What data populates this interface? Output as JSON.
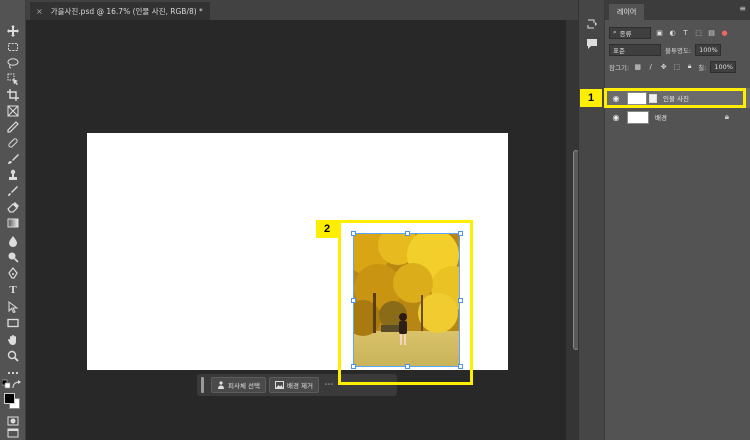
{
  "document": {
    "tab_title": "가을사진.psd @ 16.7% (인물 사진, RGB/8) *",
    "close_glyph": "×"
  },
  "toolbar": {
    "tools": [
      "move-tool",
      "marquee-tool",
      "lasso-tool",
      "object-select-tool",
      "crop-tool",
      "frame-tool",
      "eyedropper-tool",
      "healing-brush-tool",
      "brush-tool",
      "clone-stamp-tool",
      "history-brush-tool",
      "eraser-tool",
      "gradient-tool",
      "blur-tool",
      "dodge-tool",
      "pen-tool",
      "type-tool",
      "path-select-tool",
      "rectangle-tool",
      "hand-tool",
      "zoom-tool",
      "more-tools"
    ],
    "type_glyph": "T",
    "foreground_color": "#000000",
    "background_color": "#ffffff"
  },
  "taskbar": {
    "select_subject_label": "피사체 선택",
    "remove_background_label": "배경 제거",
    "more_glyph": "⋯"
  },
  "callouts": {
    "layer_callout": "1",
    "image_callout": "2",
    "highlight_color": "#ffee00"
  },
  "layers_panel": {
    "tab_label": "레이어",
    "menu_glyph": "≡",
    "filter_label": "종류",
    "blend_mode": "표준",
    "opacity_label": "불투명도:",
    "opacity_value": "100%",
    "lock_label": "잠그기:",
    "fill_label": "칠:",
    "fill_value": "100%",
    "layers": [
      {
        "name": "인물 사진",
        "selected": true,
        "visible": true,
        "smart_object": true
      },
      {
        "name": "배경",
        "selected": false,
        "visible": true,
        "locked": true
      }
    ]
  },
  "colors": {
    "canvas_bg": "#282828",
    "panel_bg": "#535353",
    "selection_blue": "#5aa7ff"
  }
}
